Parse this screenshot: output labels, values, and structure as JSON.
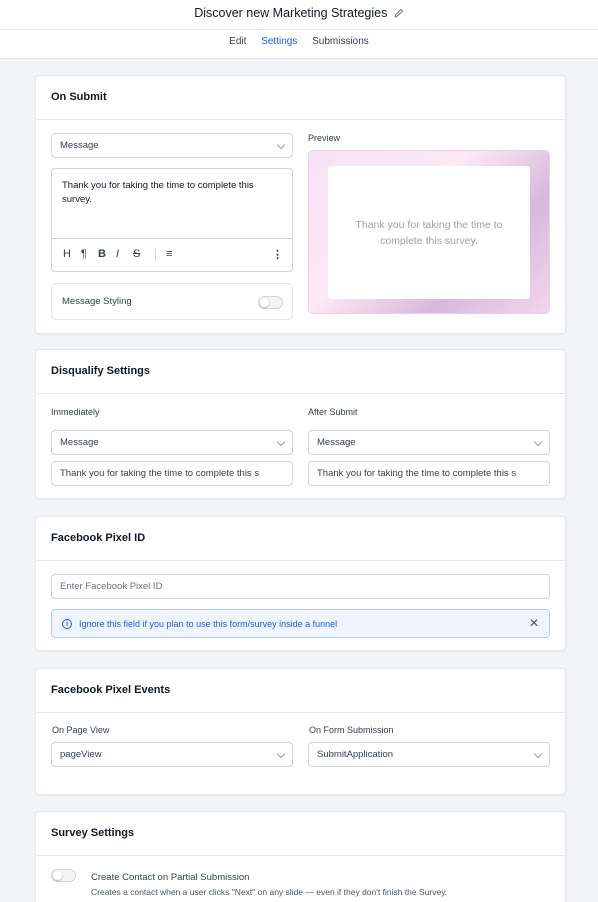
{
  "header": {
    "title": "Discover new Marketing Strategies",
    "tabs": [
      "Edit",
      "Settings",
      "Submissions"
    ],
    "active_tab": "Settings"
  },
  "on_submit": {
    "title": "On Submit",
    "action_select": "Message",
    "editor_text": "Thank you for taking the time to complete this survey.",
    "toolbar": [
      "H",
      "¶",
      "B",
      "I",
      "S",
      "≡",
      "⋮"
    ],
    "styling_label": "Message Styling",
    "styling_enabled": false,
    "preview_label": "Preview",
    "preview_text": "Thank you for taking the time to complete this survey."
  },
  "disqualify": {
    "title": "Disqualify Settings",
    "immediately_label": "Immediately",
    "immediately_select": "Message",
    "immediately_text": "Thank you for taking the time to complete this s",
    "after_label": "After Submit",
    "after_select": "Message",
    "after_text": "Thank you for taking the time to complete this s"
  },
  "pixel_id": {
    "title": "Facebook Pixel ID",
    "placeholder": "Enter Facebook Pixel ID",
    "alert": "Ignore this field if you plan to use this form/survey inside a funnel"
  },
  "pixel_events": {
    "title": "Facebook Pixel Events",
    "page_view_label": "On Page View",
    "page_view_value": "pageView",
    "submission_label": "On Form Submission",
    "submission_value": "SubmitApplication"
  },
  "survey": {
    "title": "Survey Settings",
    "option_title": "Create Contact on Partial Submission",
    "option_desc": "Creates a contact when a user clicks \"Next\" on any slide — even if they don't finish the Survey.",
    "option_enabled": false
  },
  "colors": {
    "accent": "#155eef",
    "border": "#d0d5dd",
    "bg": "#f2f4f7"
  }
}
